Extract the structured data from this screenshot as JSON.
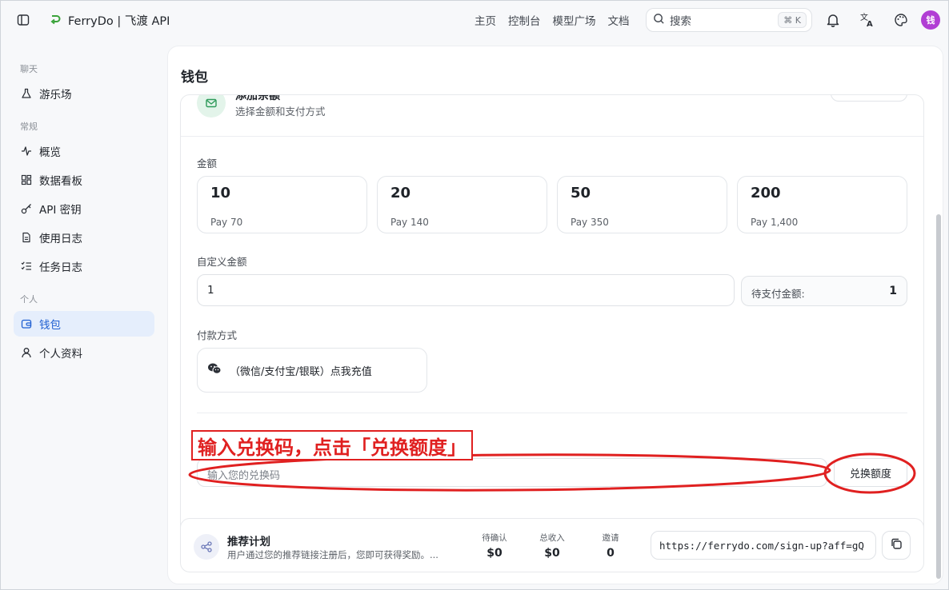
{
  "app": {
    "title": "FerryDo | 飞渡 API"
  },
  "nav": {
    "items": [
      "主页",
      "控制台",
      "模型广场",
      "文档"
    ]
  },
  "search": {
    "placeholder": "搜索",
    "shortcut": "⌘ K"
  },
  "user": {
    "avatar_text": "钱"
  },
  "sidebar": {
    "groups": [
      {
        "label": "聊天",
        "items": [
          {
            "label": "游乐场",
            "icon": "flask-icon"
          }
        ]
      },
      {
        "label": "常规",
        "items": [
          {
            "label": "概览",
            "icon": "activity-icon"
          },
          {
            "label": "数据看板",
            "icon": "dashboard-icon"
          },
          {
            "label": "API 密钥",
            "icon": "key-icon"
          },
          {
            "label": "使用日志",
            "icon": "file-text-icon"
          },
          {
            "label": "任务日志",
            "icon": "list-checks-icon"
          }
        ]
      },
      {
        "label": "个人",
        "items": [
          {
            "label": "钱包",
            "icon": "wallet-icon",
            "active": true
          },
          {
            "label": "个人资料",
            "icon": "user-icon"
          }
        ]
      }
    ]
  },
  "page": {
    "title": "钱包"
  },
  "recharge": {
    "title": "添加余额",
    "subtitle": "选择金额和支付方式",
    "amount_label": "金额",
    "options": [
      {
        "value": "10",
        "pay": "Pay 70"
      },
      {
        "value": "20",
        "pay": "Pay 140"
      },
      {
        "value": "50",
        "pay": "Pay 350"
      },
      {
        "value": "200",
        "pay": "Pay 1,400"
      }
    ],
    "custom_label": "自定义金额",
    "custom_value": "1",
    "pending_label": "待支付金额:",
    "pending_value": "1",
    "payment_label": "付款方式",
    "payment_method": "（微信/支付宝/银联）点我充值",
    "redeem_placeholder": "输入您的兑换码",
    "redeem_button": "兑换额度"
  },
  "annotation": {
    "text": "输入兑换码，点击「兑换额度」",
    "color": "#e02020"
  },
  "referral": {
    "title": "推荐计划",
    "description": "用户通过您的推荐链接注册后，您即可获得奖励。...",
    "stats": [
      {
        "label": "待确认",
        "value": "$0"
      },
      {
        "label": "总收入",
        "value": "$0"
      },
      {
        "label": "邀请",
        "value": "0"
      }
    ],
    "link": "https://ferrydo.com/sign-up?aff=gQ"
  },
  "colors": {
    "accent": "#1f5fd1",
    "active_bg": "#e5eefc",
    "avatar": "#b13ed4",
    "annotation": "#e02020"
  }
}
